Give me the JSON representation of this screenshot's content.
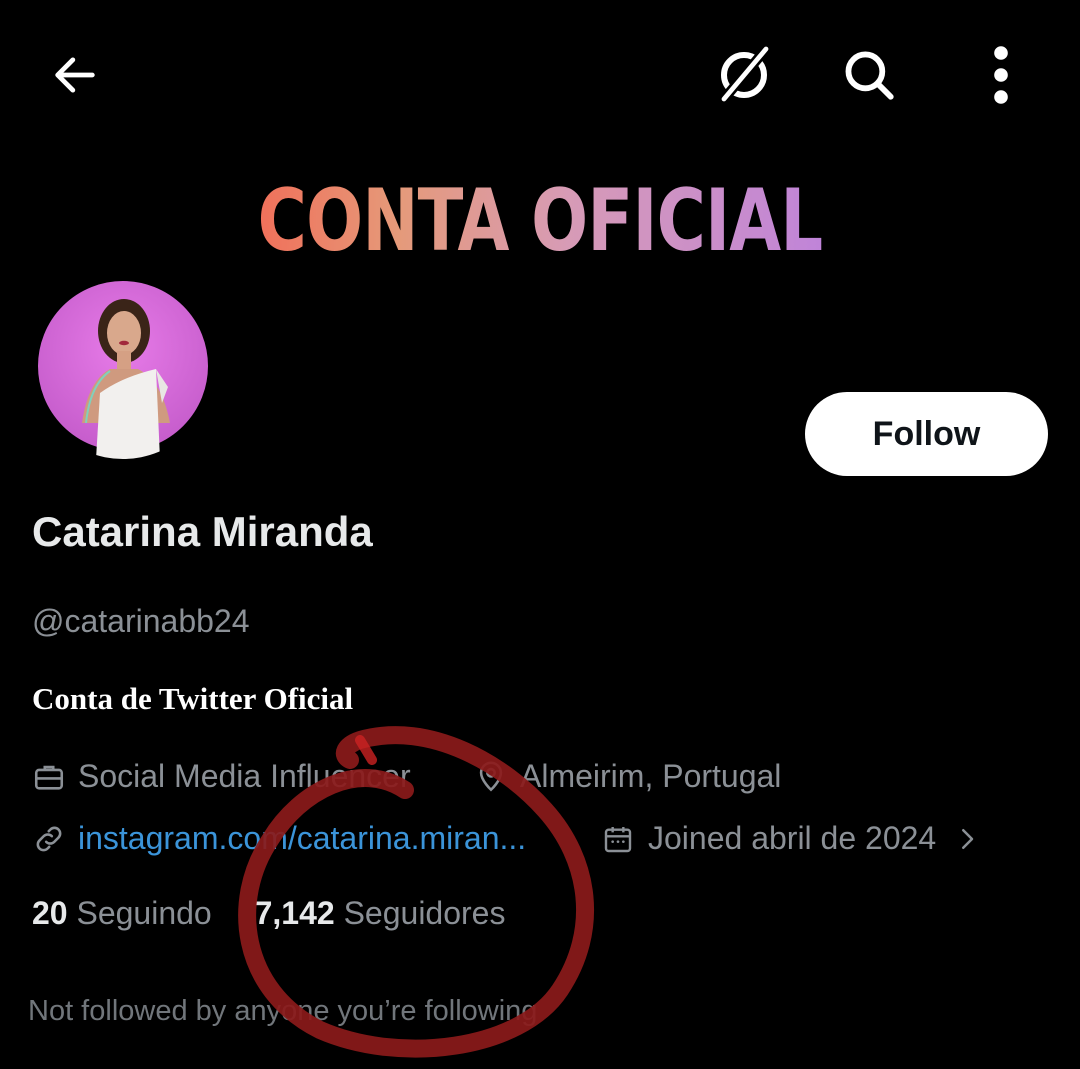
{
  "header": {
    "back_icon": "arrow-left-icon",
    "grok_icon": "grok-icon",
    "search_icon": "search-icon",
    "more_icon": "more-vertical-icon"
  },
  "banner": {
    "text": "CONTA OFICIAL"
  },
  "profile": {
    "name": "Catarina Miranda",
    "handle": "@catarinabb24",
    "bio": "Conta de Twitter Oficial",
    "category": "Social Media Influencer",
    "location": "Almeirim, Portugal",
    "website": "instagram.com/catarina.miran...",
    "joined": "Joined abril de 2024",
    "following_count": "20",
    "following_label": "Seguindo",
    "followers_count": "7,142",
    "followers_label": "Seguidores",
    "not_followed_note": "Not followed by anyone you’re following"
  },
  "follow_button": {
    "label": "Follow"
  },
  "colors": {
    "background": "#000000",
    "text_primary": "#e7e9ea",
    "text_secondary": "#8b9096",
    "link": "#3b94d9",
    "annotation": "#8b1a1a",
    "avatar_bg": "#d26ad6"
  }
}
